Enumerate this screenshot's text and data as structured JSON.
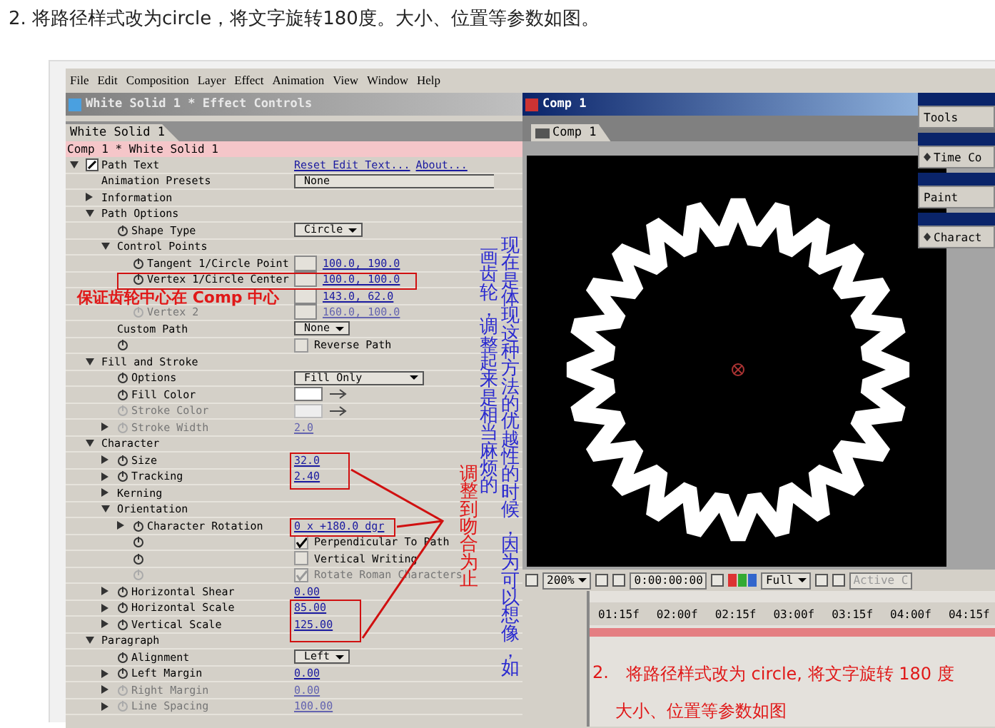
{
  "heading": "2. 将路径样式改为circle，将文字旋转180度。大小、位置等参数如图。",
  "menu_bar": [
    "File",
    "Edit",
    "Composition",
    "Layer",
    "Effect",
    "Animation",
    "View",
    "Window",
    "Help"
  ],
  "effect_controls": {
    "title": "White Solid 1 * Effect Controls",
    "tab": "White Solid 1",
    "layer_path": "Comp 1 * White Solid 1",
    "rows": [
      {
        "label": "Path Text",
        "expanded": true,
        "disabled": false,
        "value": {
          "kind": "links",
          "items": [
            "Reset Edit Text...",
            "About..."
          ]
        },
        "children": [
          {
            "label": "Animation Presets",
            "disabled": false,
            "value": {
              "kind": "preset",
              "text": "None"
            }
          },
          {
            "label": "Information",
            "expanded": false,
            "disabled": false
          },
          {
            "label": "Path Options",
            "expanded": true,
            "disabled": false,
            "children": [
              {
                "label": "Shape Type",
                "stopwatch": true,
                "disabled": false,
                "value": {
                  "kind": "dropdown",
                  "text": "Circle"
                }
              },
              {
                "label": "Control Points",
                "expanded": true,
                "disabled": false,
                "children": [
                  {
                    "label": "Tangent 1/Circle Point",
                    "stopwatch": true,
                    "disabled": false,
                    "value": {
                      "kind": "point",
                      "text": "100.0, 190.0"
                    }
                  },
                  {
                    "label": "Vertex 1/Circle Center",
                    "stopwatch": true,
                    "disabled": false,
                    "value": {
                      "kind": "point",
                      "text": "100.0, 100.0"
                    }
                  },
                  {
                    "disabled": false,
                    "value": {
                      "kind": "point",
                      "text": "143.0, 62.0"
                    }
                  },
                  {
                    "label": "Vertex 2",
                    "stopwatch": true,
                    "disabled": true,
                    "value": {
                      "kind": "point",
                      "text": "160.0, 100.0"
                    }
                  }
                ]
              },
              {
                "label": "Custom Path",
                "disabled": false,
                "value": {
                  "kind": "dropdown",
                  "text": "None"
                }
              },
              {
                "stopwatch": true,
                "disabled": false,
                "value": {
                  "kind": "checkbox",
                  "text": "Reverse Path",
                  "checked": false
                }
              }
            ]
          },
          {
            "label": "Fill and Stroke",
            "expanded": true,
            "disabled": false,
            "children": [
              {
                "label": "Options",
                "stopwatch": true,
                "disabled": false,
                "value": {
                  "kind": "dropdown-wide",
                  "text": "Fill Only"
                }
              },
              {
                "label": "Fill Color",
                "stopwatch": true,
                "disabled": false,
                "value": {
                  "kind": "color"
                }
              },
              {
                "label": "Stroke Color",
                "stopwatch": true,
                "disabled": true,
                "value": {
                  "kind": "color"
                }
              },
              {
                "label": "Stroke Width",
                "expanded": false,
                "stopwatch": true,
                "disabled": true,
                "value": {
                  "kind": "number",
                  "text": "2.0"
                }
              }
            ]
          },
          {
            "label": "Character",
            "expanded": true,
            "disabled": false,
            "children": [
              {
                "label": "Size",
                "expanded": false,
                "stopwatch": true,
                "disabled": false,
                "value": {
                  "kind": "number",
                  "text": "32.0"
                }
              },
              {
                "label": "Tracking",
                "expanded": false,
                "stopwatch": true,
                "disabled": false,
                "value": {
                  "kind": "number",
                  "text": "2.40"
                }
              },
              {
                "label": "Kerning",
                "expanded": false,
                "disabled": false
              },
              {
                "label": "Orientation",
                "expanded": true,
                "disabled": false,
                "children": [
                  {
                    "label": "Character Rotation",
                    "expanded": false,
                    "stopwatch": true,
                    "disabled": false,
                    "value": {
                      "kind": "number",
                      "text": "0 x +180.0 dgr"
                    }
                  },
                  {
                    "stopwatch": true,
                    "disabled": false,
                    "value": {
                      "kind": "checkbox",
                      "text": "Perpendicular To Path",
                      "checked": true
                    }
                  },
                  {
                    "stopwatch": true,
                    "disabled": false,
                    "value": {
                      "kind": "checkbox",
                      "text": "Vertical Writing",
                      "checked": false
                    }
                  },
                  {
                    "stopwatch": true,
                    "disabled": true,
                    "value": {
                      "kind": "checkbox",
                      "text": "Rotate Roman Characters",
                      "checked": true
                    }
                  }
                ]
              },
              {
                "label": "Horizontal Shear",
                "expanded": false,
                "stopwatch": true,
                "disabled": false,
                "value": {
                  "kind": "number",
                  "text": "0.00"
                }
              },
              {
                "label": "Horizontal Scale",
                "expanded": false,
                "stopwatch": true,
                "disabled": false,
                "value": {
                  "kind": "number",
                  "text": "85.00"
                }
              },
              {
                "label": "Vertical Scale",
                "expanded": false,
                "stopwatch": true,
                "disabled": false,
                "value": {
                  "kind": "number",
                  "text": "125.00"
                }
              }
            ]
          },
          {
            "label": "Paragraph",
            "expanded": true,
            "disabled": false,
            "children": [
              {
                "label": "Alignment",
                "stopwatch": true,
                "disabled": false,
                "value": {
                  "kind": "dropdown",
                  "text": "Left"
                }
              },
              {
                "label": "Left Margin",
                "expanded": false,
                "stopwatch": true,
                "disabled": false,
                "value": {
                  "kind": "number",
                  "text": "0.00"
                }
              },
              {
                "label": "Right Margin",
                "expanded": false,
                "stopwatch": true,
                "disabled": true,
                "value": {
                  "kind": "number",
                  "text": "0.00"
                }
              },
              {
                "label": "Line Spacing",
                "expanded": false,
                "stopwatch": true,
                "disabled": true,
                "value": {
                  "kind": "number",
                  "text": "100.00"
                }
              }
            ]
          }
        ]
      }
    ]
  },
  "annotations": {
    "center_note": "保证齿轮中心在 Comp 中心",
    "adjust_note": "调整到吻合为止",
    "comment_columns": [
      "现在是体现这种方法的优越性的时候，因为可以想像，如",
      "画齿轮，调整起来是相当麻烦的"
    ]
  },
  "composition": {
    "title": "Comp 1",
    "tab": "Comp 1",
    "zoom": "200%",
    "timecode": "0:00:00:00",
    "resolution": "Full",
    "view": "Active C"
  },
  "palettes": [
    {
      "label": "Tools",
      "menu_icon": false
    },
    {
      "label": "Time Co",
      "menu_icon": true
    },
    {
      "label": "Paint",
      "menu_icon": false
    },
    {
      "label": "Charact",
      "menu_icon": true
    }
  ],
  "timeline": {
    "ruler": [
      "01:15f",
      "02:00f",
      "02:15f",
      "03:00f",
      "03:15f",
      "04:00f",
      "04:15f"
    ],
    "note_number": "2.",
    "note_lines": [
      "将路径样式改为 circle, 将文字旋转 180 度",
      "大小、位置等参数如图"
    ]
  }
}
